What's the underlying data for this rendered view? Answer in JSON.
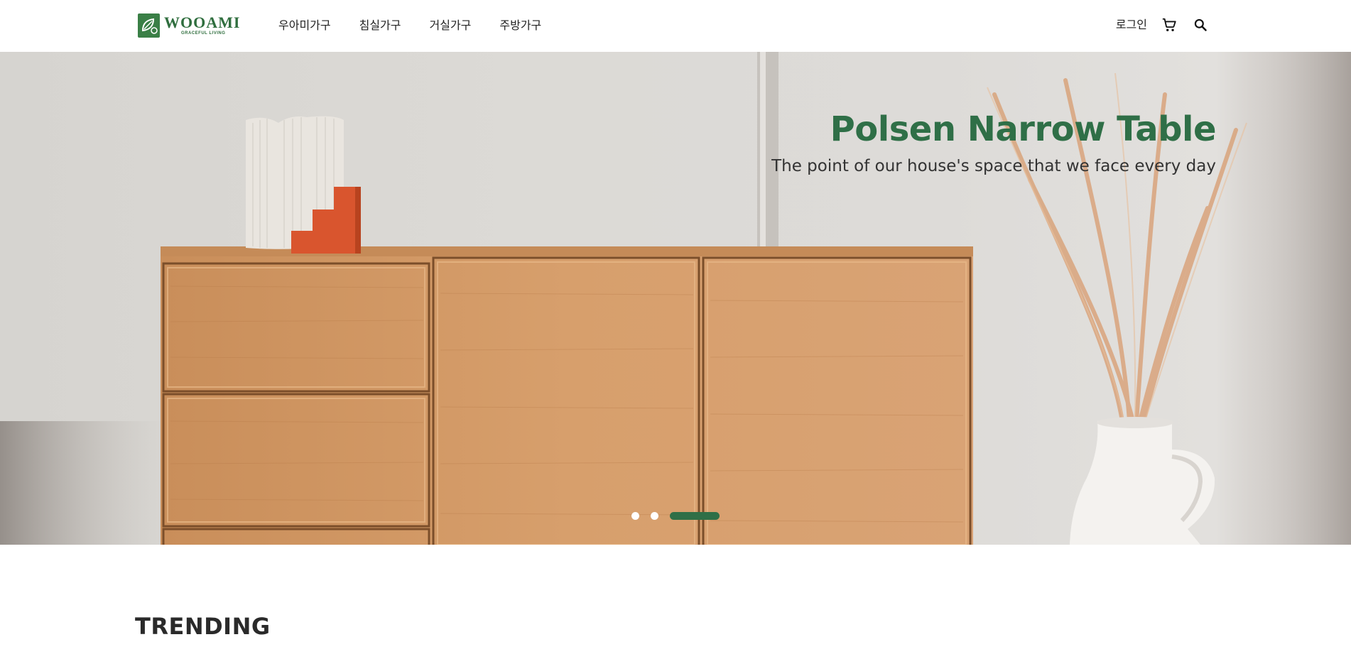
{
  "brand": {
    "name": "WOOAMI",
    "tagline": "GRACEFUL LIVING"
  },
  "nav": {
    "items": [
      {
        "label": "우아미가구"
      },
      {
        "label": "침실가구"
      },
      {
        "label": "거실가구"
      },
      {
        "label": "주방가구"
      }
    ]
  },
  "util": {
    "login_label": "로그인",
    "cart_icon": "cart-icon",
    "search_icon": "search-icon"
  },
  "hero": {
    "title": "Polsen Narrow Table",
    "subtitle": "The point of our house's space that we face every day",
    "slides_total": 3,
    "active_slide": 3
  },
  "trending": {
    "title": "TRENDING"
  },
  "colors": {
    "brand_green": "#2f6f47",
    "text_dark": "#222222",
    "background": "#ffffff"
  }
}
